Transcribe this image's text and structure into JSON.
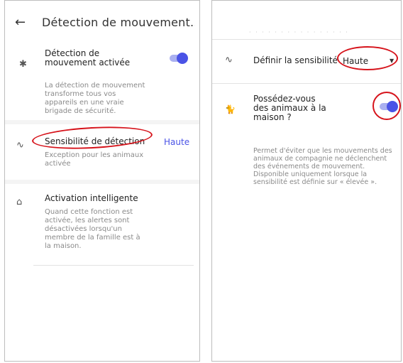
{
  "left": {
    "header": {
      "title": "Détection de mouvement..."
    },
    "motion": {
      "label_line1": "Détection de",
      "label_line2": "mouvement activée",
      "desc": [
        "La détection de mouvement",
        "transforme tous vos",
        "appareils en une vraie",
        "brigade de sécurité."
      ]
    },
    "sensitivity": {
      "label": "Sensibilité de détection",
      "value": "Haute",
      "desc": [
        "Exception pour les animaux",
        "activée"
      ]
    },
    "smart": {
      "label": "Activation intelligente",
      "desc": [
        "Quand cette fonction est",
        "activée, les alertes sont",
        "désactivées lorsqu'un",
        "membre de la famille est à",
        "la maison."
      ]
    }
  },
  "right": {
    "sensitivity": {
      "label": "Définir la sensibilité",
      "selected": "Haute"
    },
    "pets": {
      "label": [
        "Possédez-vous",
        "des animaux à la",
        "maison ?"
      ],
      "desc": [
        "Permet d'éviter que les mouvements des",
        "animaux de compagnie ne déclenchent",
        "des événements de mouvement.",
        "Disponible uniquement lorsque la",
        "sensibilité est définie sur « élevée »."
      ]
    },
    "faded_text": "· · · · · · · · · · · · · · · ·"
  }
}
